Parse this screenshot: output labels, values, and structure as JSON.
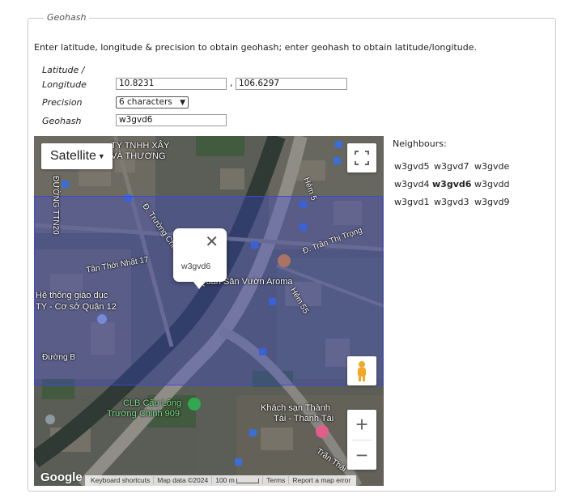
{
  "section": {
    "legend": "Geohash",
    "intro": "Enter latitude, longitude & precision to obtain geohash; enter geohash to obtain latitude/longitude."
  },
  "form": {
    "latlon_label_line1": "Latitude /",
    "latlon_label_line2": "Longitude",
    "latitude": "10.8231",
    "comma": ",",
    "longitude": "106.6297",
    "precision_label": "Precision",
    "precision_value": "6 characters",
    "geohash_label": "Geohash",
    "geohash": "w3gvd6"
  },
  "map": {
    "map_type": "Satellite",
    "popup_text": "w3gvd6",
    "google_logo": "Google",
    "attribution": {
      "shortcuts": "Keyboard shortcuts",
      "data": "Map data ©2024",
      "scale": "100 m",
      "terms": "Terms",
      "report": "Report a map error"
    },
    "labels": [
      "TY TNHH XÂY",
      "VÀ THƯƠNG",
      "Hẻm 5",
      "ĐƯỜNG TTN20",
      "Đ. Trường Chinh",
      "Tân Thới Nhất 17",
      "Đ. Trần Thị Trọng",
      "Quán Sân Vườn Aroma",
      "Hệ thống giáo dục",
      "TY - Cơ sở Quận 12",
      "Hẻm 55",
      "Đường B",
      "CLB Cầu Lông",
      "Trường Chinh 909",
      "Khách sạn Thành",
      "Tài - Thanh Tài",
      "Trần Thái"
    ],
    "colors": {
      "geohash_fill": "#3746dc",
      "geohash_border": "#3c46e6"
    }
  },
  "neighbours": {
    "title": "Neighbours:",
    "rows": [
      [
        "w3gvd5",
        "w3gvd7",
        "w3gvde"
      ],
      [
        "w3gvd4",
        "w3gvd6",
        "w3gvdd"
      ],
      [
        "w3gvd1",
        "w3gvd3",
        "w3gvd9"
      ]
    ]
  }
}
